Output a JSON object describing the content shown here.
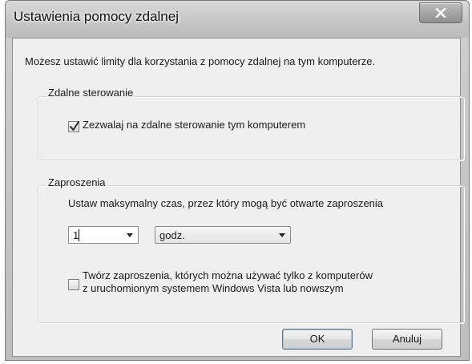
{
  "window": {
    "title": "Ustawienia pomocy zdalnej",
    "close_symbol": "X"
  },
  "intro_text": "Możesz ustawić limity dla korzystania z pomocy zdalnej na tym komputerze.",
  "remote_control": {
    "group_label": "Zdalne sterowanie",
    "allow_label": "Zezwalaj na zdalne sterowanie tym komputerem",
    "allow_checked": true
  },
  "invitations": {
    "group_label": "Zaproszenia",
    "max_time_label": "Ustaw maksymalny czas, przez który mogą być otwarte zaproszenia",
    "time_value": "1",
    "time_unit": "godz.",
    "vista_line1": "Twórz zaproszenia, których można używać tylko z komputerów",
    "vista_line2": "z uruchomionym systemem Windows Vista lub nowszym",
    "vista_checked": false
  },
  "buttons": {
    "ok": "OK",
    "cancel": "Anuluj"
  },
  "icons": {
    "close": "close-icon",
    "check": "checkmark-icon",
    "dropdown": "chevron-down-icon"
  }
}
